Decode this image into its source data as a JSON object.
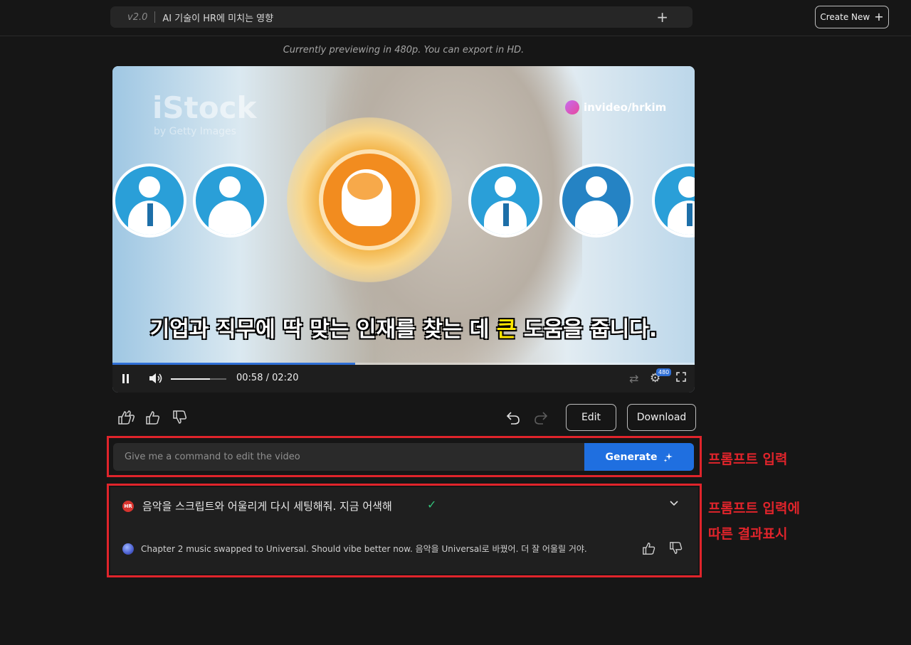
{
  "header": {
    "version": "v2.0",
    "project_title": "AI 기술이 HR에 미치는 영향",
    "add_label": "+",
    "create_new_label": "Create New",
    "create_new_icon": "+"
  },
  "preview_note": "Currently previewing in 480p. You can export in HD.",
  "video": {
    "watermark": "iStock",
    "watermark_sub": "by Getty Images",
    "brand": "invideo/hrkim",
    "subtitle_before": "기업과 직무에 딱 맞는 인재를 찾는 데 ",
    "subtitle_highlight": "큰",
    "subtitle_after": " 도움을 줍니다.",
    "highlight_color": "#ffe600",
    "time": "00:58 / 02:20",
    "progress": 0.417,
    "volume": 0.7,
    "quality": "480"
  },
  "actions": {
    "edit_label": "Edit",
    "download_label": "Download"
  },
  "prompt": {
    "placeholder": "Give me a command to edit the video",
    "generate_label": "Generate",
    "annotation": "프롬프트 입력"
  },
  "result": {
    "user_avatar": "HR",
    "user_message": "음악을 스크립트와 어울리게 다시 세팅해줘. 지금 어색해",
    "bot_message": "Chapter 2 music swapped to Universal. Should vibe better now. 음악을 Universal로 바꿨어. 더 잘 어울릴 거야.",
    "annotation_line1": "프롬프트 입력에",
    "annotation_line2": "따른 결과표시"
  },
  "colors": {
    "accent": "#1f6fe0",
    "annotation_red": "#e0242b",
    "background": "#161616",
    "check_green": "#33c27a"
  }
}
